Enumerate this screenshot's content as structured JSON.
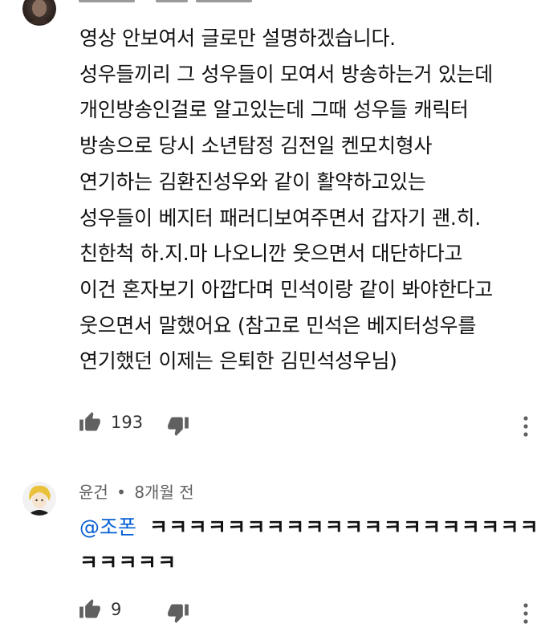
{
  "comments": [
    {
      "lines": [
        "영상 안보여서 글로만 설명하겠습니다.",
        "성우들끼리 그 성우들이 모여서 방송하는거 있는데",
        "개인방송인걸로 알고있는데 그때 성우들 캐릭터",
        "방송으로 당시 소년탐정 김전일 켄모치형사",
        "연기하는 김환진성우와 같이 활약하고있는",
        "성우들이 베지터 패러디보여주면서 갑자기 괜.히.",
        "친한척 하.지.마 나오니깐 웃으면서 대단하다고",
        "이건 혼자보기 아깝다며 민석이랑 같이 봐야한다고",
        "웃으면서 말했어요 (참고로 민석은 베지터성우를",
        "연기했던 이제는 은퇴한 김민석성우님)"
      ],
      "likes": "193"
    },
    {
      "author": "윤건",
      "separator": "•",
      "time": "8개월 전",
      "mention": "@조폰",
      "text_line1": "ㅋㅋㅋㅋㅋㅋㅋㅋㅋㅋㅋㅋㅋㅋㅋㅋㅋㅋㅋㅋ",
      "text_line2": "ㅋㅋㅋㅋㅋ",
      "likes": "9"
    }
  ],
  "icons": {
    "like": "thumb-up-icon",
    "dislike": "thumb-down-icon",
    "more": "more-vert-icon"
  },
  "colors": {
    "text": "#111111",
    "meta": "#606060",
    "mention": "#065fd4",
    "icon": "#606060"
  }
}
